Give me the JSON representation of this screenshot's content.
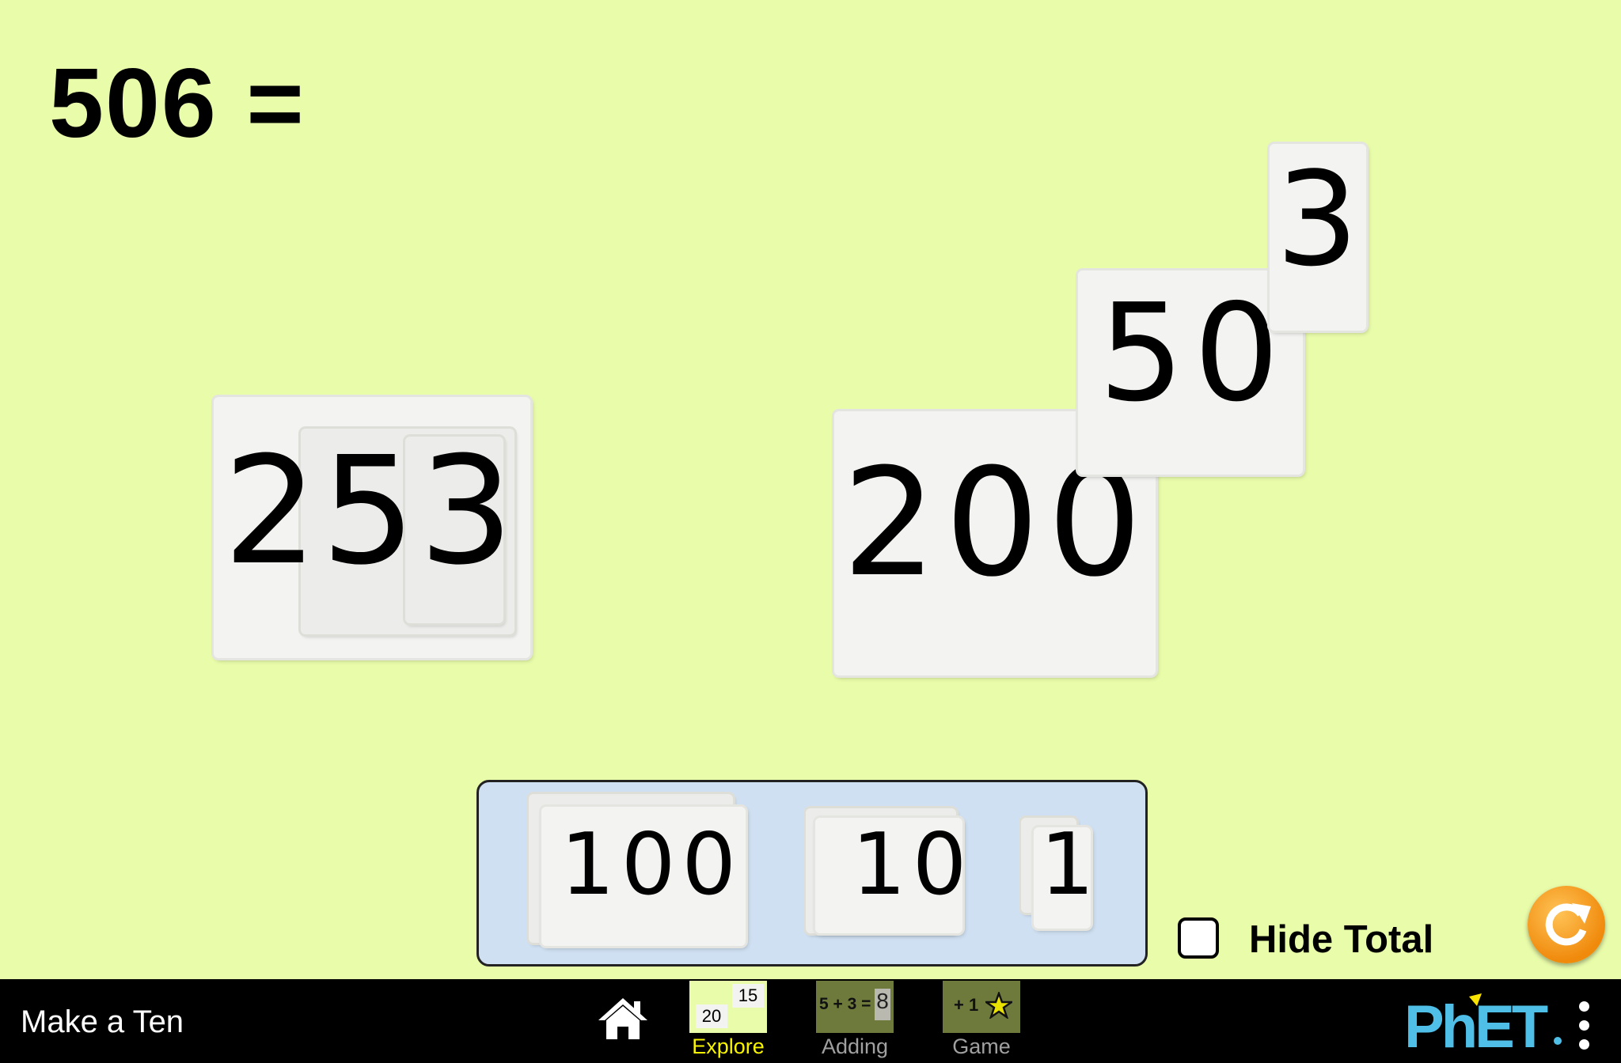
{
  "equation": {
    "text": "506 ="
  },
  "number_groups": [
    {
      "name": "group-253",
      "value": "253",
      "parts": [
        "200",
        "50",
        "3"
      ]
    },
    {
      "name": "group-253-expanded",
      "parts": [
        {
          "label": "200"
        },
        {
          "label": "50"
        },
        {
          "label": "3"
        }
      ]
    }
  ],
  "kit": {
    "cards": [
      {
        "label": "100"
      },
      {
        "label": "10"
      },
      {
        "label": "1"
      }
    ]
  },
  "hide_total": {
    "label": "Hide Total",
    "checked": false
  },
  "navbar": {
    "title": "Make a Ten",
    "screens": [
      {
        "label": "Explore",
        "active": true,
        "icon_text_a": "20",
        "icon_text_b": "15",
        "color": "#f8f400"
      },
      {
        "label": "Adding",
        "active": false,
        "icon_text": "5 + 3 =",
        "icon_result": "8",
        "color": "#a0a0a0"
      },
      {
        "label": "Game",
        "active": false,
        "icon_text": "+ 1",
        "color": "#a0a0a0"
      }
    ],
    "brand": "PhET"
  },
  "colors": {
    "background": "#e9fcaa",
    "kit_background": "#cfe0f2",
    "reset": "#f08a0c",
    "phet_blue": "#4fbfe8",
    "phet_yellow": "#f9e300"
  }
}
